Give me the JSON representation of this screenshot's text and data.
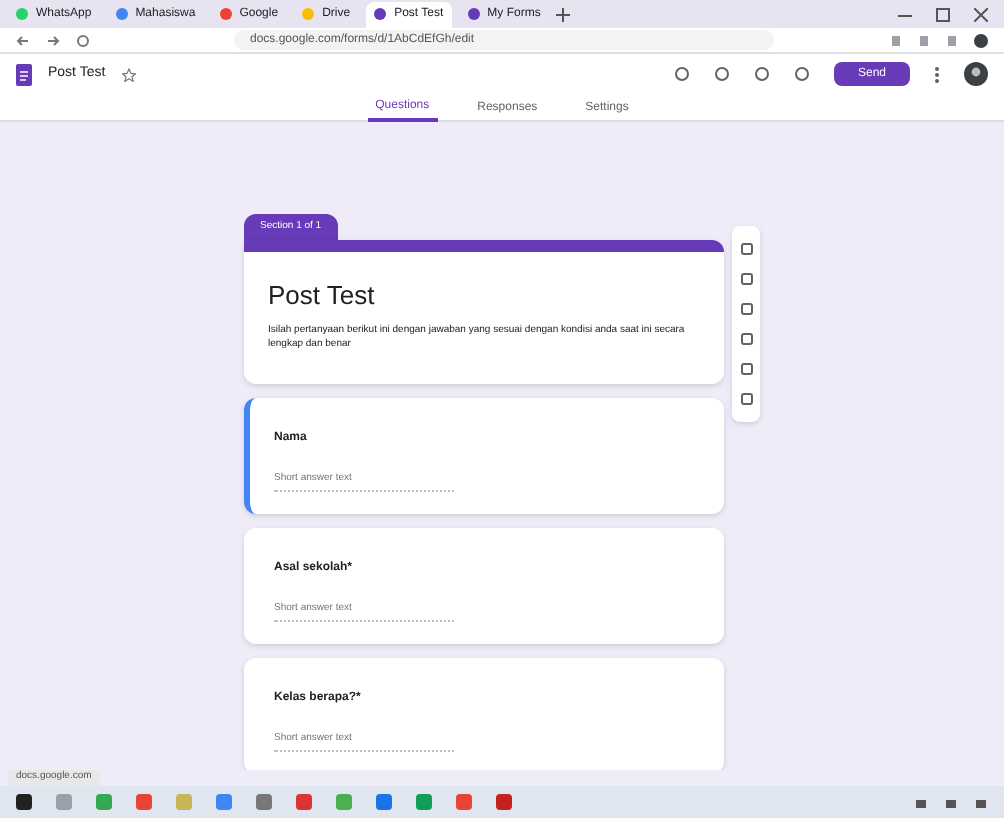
{
  "browser": {
    "tabs": [
      {
        "label": "WhatsApp",
        "selected": false,
        "color": "#25d366"
      },
      {
        "label": "Mahasiswa",
        "selected": false,
        "color": "#4285f4"
      },
      {
        "label": "Google",
        "selected": false,
        "color": "#ea4335"
      },
      {
        "label": "Drive",
        "selected": false,
        "color": "#fbbc04"
      },
      {
        "label": "Post Test",
        "selected": true,
        "color": "#673ab7"
      },
      {
        "label": "My Forms",
        "selected": false,
        "color": "#673ab7"
      }
    ],
    "address": "docs.google.com/forms/d/1AbCdEfGh/edit"
  },
  "header": {
    "doc_name": "Post Test",
    "send": "Send"
  },
  "form_tabs": [
    {
      "label": "Questions",
      "selected": true
    },
    {
      "label": "Responses",
      "selected": false
    },
    {
      "label": "Settings",
      "selected": false
    }
  ],
  "section_tab": "Section 1 of 1",
  "title": "Post Test",
  "description": "Isilah pertanyaan berikut ini dengan jawaban yang sesuai dengan kondisi anda saat ini secara lengkap dan benar",
  "questions": [
    {
      "label": "Nama",
      "placeholder": "Short answer text",
      "selected": true
    },
    {
      "label": "Asal sekolah*",
      "placeholder": "Short answer text",
      "selected": false
    },
    {
      "label": "Kelas berapa?*",
      "placeholder": "Short answer text",
      "selected": false
    }
  ],
  "status_text": "docs.google.com"
}
